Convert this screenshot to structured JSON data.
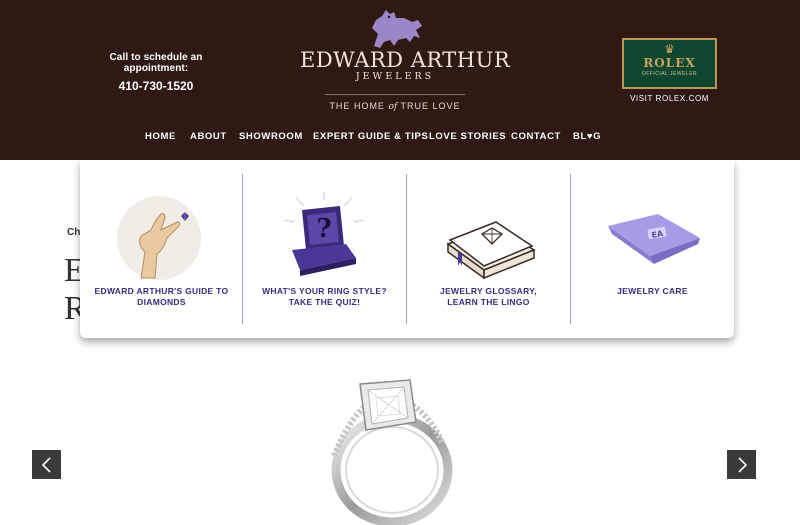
{
  "header": {
    "appointment_line": "Call to schedule an appointment:",
    "phone": "410-730-1520",
    "brand_name": "EDWARD ARTHUR",
    "brand_sub": "JEWELERS",
    "tagline_pre": "THE HOME ",
    "tagline_of": "of",
    "tagline_post": " TRUE LOVE",
    "rolex_name": "ROLEX",
    "rolex_sub": "OFFICIAL JEWELER",
    "visit_rolex": "VISIT ROLEX.COM"
  },
  "nav": {
    "items": [
      {
        "label": "HOME"
      },
      {
        "label": "ABOUT"
      },
      {
        "label": "SHOWROOM"
      },
      {
        "label": "EXPERT GUIDE & TIPS"
      },
      {
        "label": "LOVE STORIES"
      },
      {
        "label": "CONTACT"
      },
      {
        "label": "BL♥G"
      }
    ]
  },
  "dropdown": {
    "items": [
      {
        "line1": "EDWARD ARTHUR'S GUIDE TO",
        "line2": "DIAMONDS",
        "icon": "hand-diamond-icon"
      },
      {
        "line1": "WHAT'S YOUR RING STYLE?",
        "line2": "TAKE THE QUIZ!",
        "icon": "ring-box-question-icon"
      },
      {
        "line1": "JEWELRY GLOSSARY,",
        "line2": "LEARN THE LINGO",
        "icon": "glossary-book-icon"
      },
      {
        "line1": "JEWELRY CARE",
        "line2": "",
        "icon": "polishing-cloth-icon"
      }
    ]
  },
  "page_peek": {
    "small": "Chu",
    "big1": "E",
    "big2": "R"
  },
  "slider": {
    "prev_icon": "chevron-left-icon",
    "next_icon": "chevron-right-icon"
  },
  "colors": {
    "header_bg": "#2e1a13",
    "accent_purple": "#3d2a86",
    "rolex_green": "#0e4630",
    "rolex_gold": "#c9a45c"
  }
}
